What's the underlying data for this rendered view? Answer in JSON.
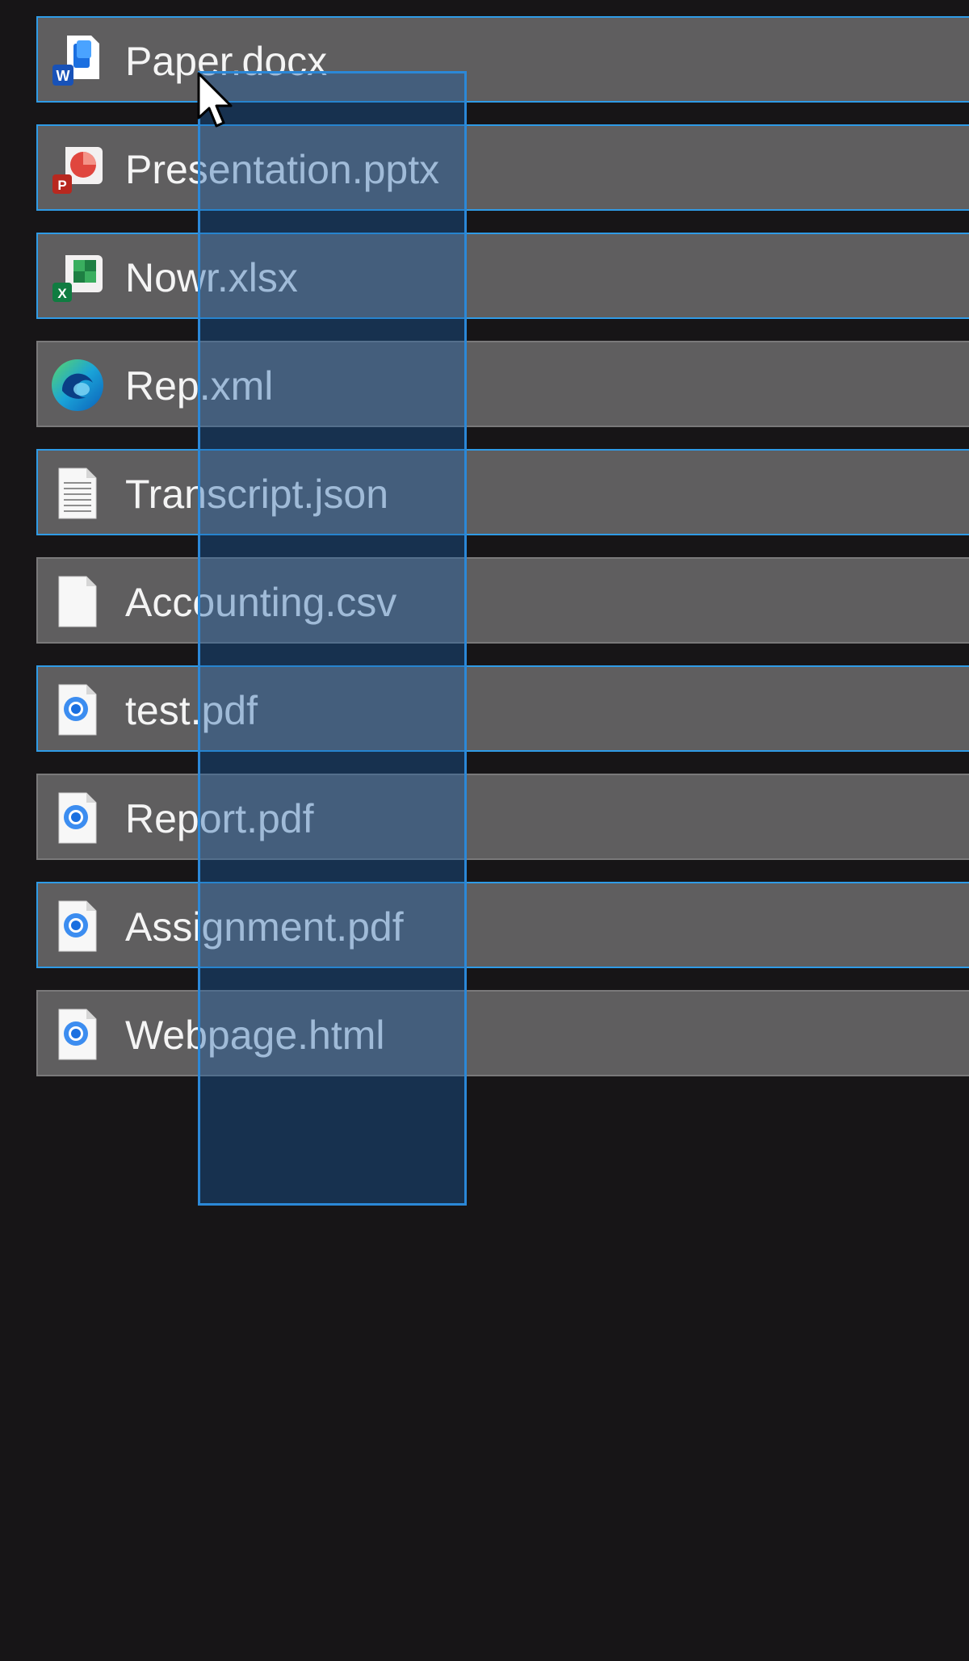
{
  "files": [
    {
      "name": "Paper.docx",
      "icon": "word-document-icon",
      "selected": true
    },
    {
      "name": "Presentation.pptx",
      "icon": "powerpoint-document-icon",
      "selected": true
    },
    {
      "name": "Nowr.xlsx",
      "icon": "excel-document-icon",
      "selected": true
    },
    {
      "name": "Rep.xml",
      "icon": "edge-browser-icon",
      "selected": false
    },
    {
      "name": "Transcript.json",
      "icon": "text-document-icon",
      "selected": true
    },
    {
      "name": "Accounting.csv",
      "icon": "blank-document-icon",
      "selected": false
    },
    {
      "name": "test.pdf",
      "icon": "chrome-document-icon",
      "selected": true
    },
    {
      "name": "Report.pdf",
      "icon": "chrome-document-icon",
      "selected": false
    },
    {
      "name": "Assignment.pdf",
      "icon": "chrome-document-icon",
      "selected": true
    },
    {
      "name": "Webpage.html",
      "icon": "chrome-document-icon",
      "selected": false
    }
  ],
  "colors": {
    "background": "#171517",
    "row_fill": "#5f5e5f",
    "selection_border": "#2f9be6",
    "marquee_fill": "#185faa",
    "marquee_border": "#2b88d8",
    "label_text": "#f4f4f4"
  }
}
